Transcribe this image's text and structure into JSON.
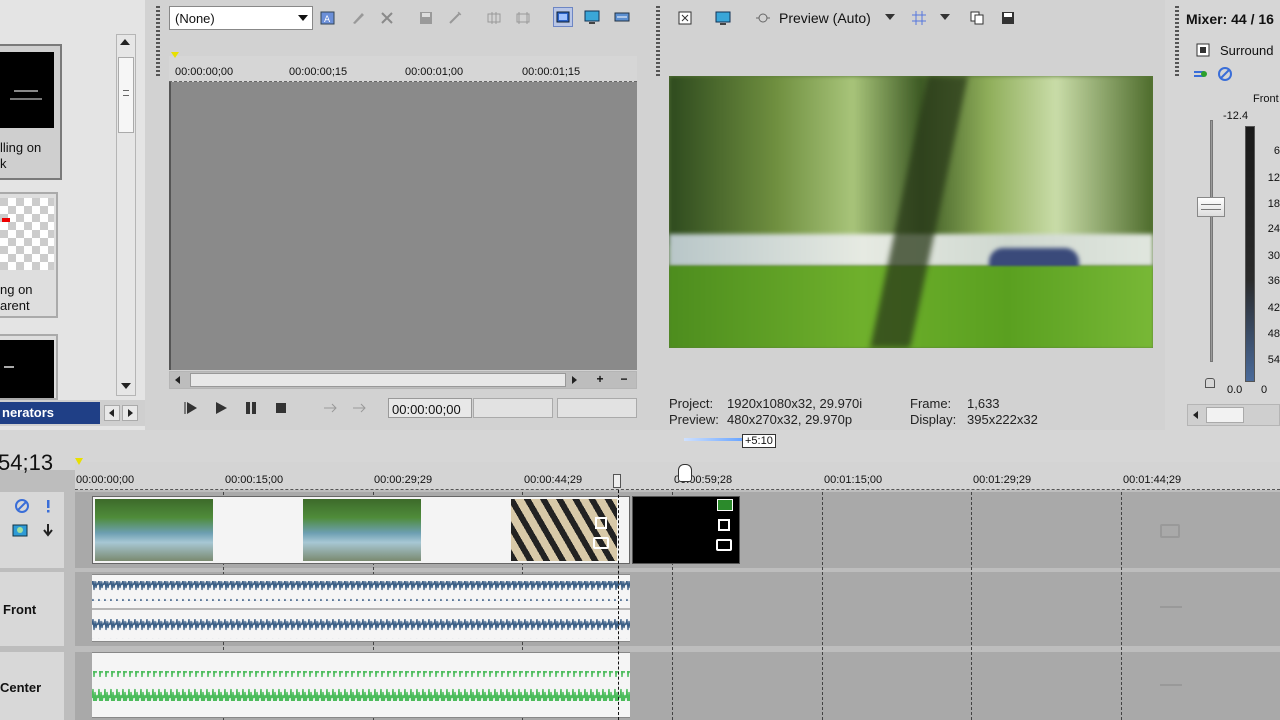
{
  "media_panel": {
    "items": [
      {
        "caption": "lling on\nk"
      },
      {
        "caption": "ng on\narent"
      },
      {
        "caption": ""
      }
    ],
    "tab_label": "nerators"
  },
  "trimmer": {
    "dropdown_value": "(None)",
    "ruler_ticks": [
      "00:00:00;00",
      "00:00:00;15",
      "00:00:01;00",
      "00:00:01;15"
    ],
    "timecode": "00:00:00;00"
  },
  "preview": {
    "mode_label": "Preview (Auto)",
    "project_label": "Project:",
    "project_value": "1920x1080x32, 29.970i",
    "preview_label": "Preview:",
    "preview_value": "480x270x32, 29.970p",
    "frame_label": "Frame:",
    "frame_value": "1,633",
    "display_label": "Display:",
    "display_value": "395x222x32"
  },
  "mixer": {
    "title": "Mixer: 44 / 16",
    "bus_name": "Surround",
    "channel_label": "Front",
    "peak_value": "-12.4",
    "scale": [
      "6",
      "12",
      "18",
      "24",
      "30",
      "36",
      "42",
      "48",
      "54"
    ],
    "fader_value": "0.0",
    "meter_zero": "0"
  },
  "timeline": {
    "cursor_time": "54;13",
    "offset_badge": "+5:10",
    "ruler_ticks": [
      "00:00:00;00",
      "00:00:15;00",
      "00:00:29;29",
      "00:00:44;29",
      "00:00:59;28",
      "00:01:15;00",
      "00:01:29;29",
      "00:01:44;29"
    ],
    "tracks": [
      {
        "name": ""
      },
      {
        "name": "Front"
      },
      {
        "name": "Center"
      }
    ]
  }
}
